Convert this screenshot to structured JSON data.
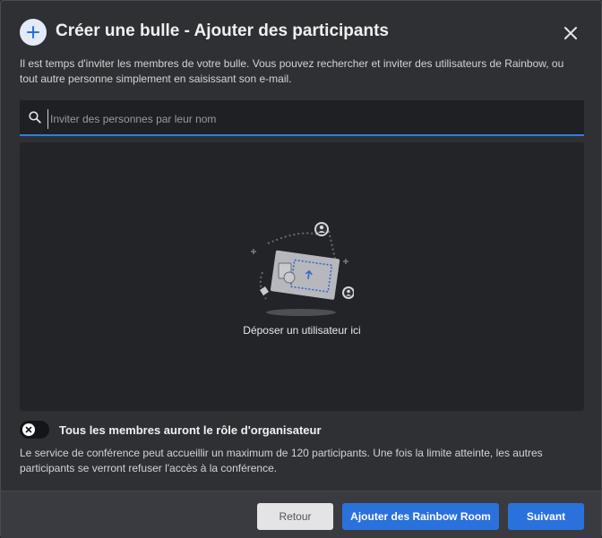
{
  "dialog": {
    "title": "Créer une bulle - Ajouter des participants",
    "description": "Il est temps d'inviter les membres de votre bulle. Vous pouvez rechercher et inviter des utilisateurs de Rainbow, ou tout autre personne simplement en saisissant son e-mail.",
    "icons": {
      "header": "plus-icon",
      "close": "close-icon",
      "search": "search-icon",
      "toggle": "x-icon"
    }
  },
  "search": {
    "placeholder": "Inviter des personnes par leur nom",
    "value": ""
  },
  "dropzone": {
    "label": "Déposer un utilisateur ici"
  },
  "organizer_toggle": {
    "label": "Tous les membres auront le rôle d'organisateur",
    "enabled": false
  },
  "limit_note": "Le service de conférence peut accueillir un maximum de 120 participants. Une fois la limite atteinte, les autres participants se verront refuser l'accès à la conférence.",
  "footer": {
    "back_label": "Retour",
    "add_room_label": "Ajouter des Rainbow Room",
    "next_label": "Suivant"
  },
  "colors": {
    "accent": "#2a71dc",
    "background": "#2f3034",
    "panel": "#232428"
  }
}
